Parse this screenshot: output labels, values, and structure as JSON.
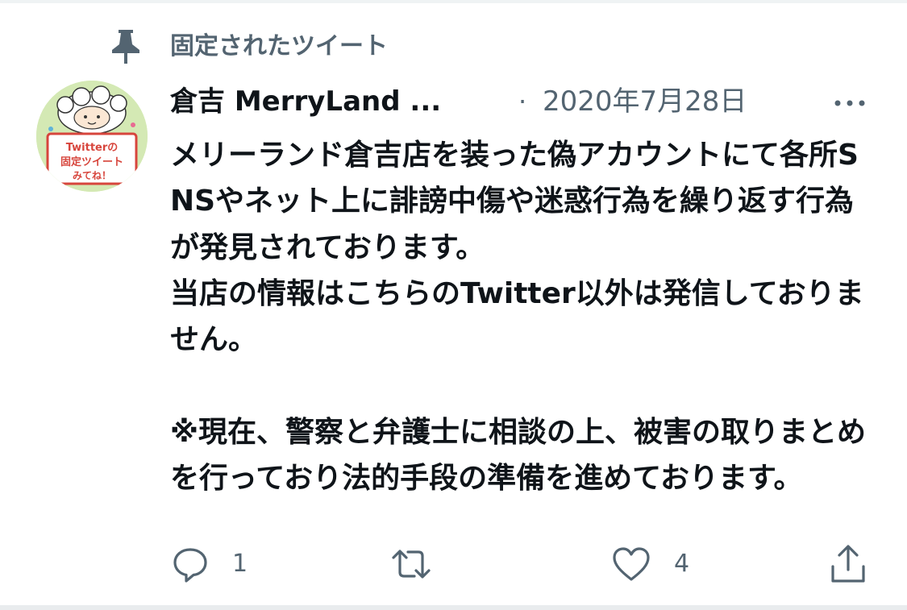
{
  "pinned": {
    "label": "固定されたツイート"
  },
  "tweet": {
    "display_name": "倉吉 MerryLand ...",
    "separator": "·",
    "timestamp": "2020年7月28日",
    "body": "メリーランド倉吉店を装った偽アカウントにて各所SNSやネット上に誹謗中傷や迷惑行為を繰り返す行為が発見されております。\n当店の情報はこちらのTwitter以外は発信しておりません。\n\n※現在、警察と弁護士に相談の上、被害の取りまとめを行っており法的手段の準備を進めております。"
  },
  "avatar": {
    "sign_line1": "Twitterの",
    "sign_line2": "固定ツイート",
    "sign_line3": "みてね！"
  },
  "actions": {
    "reply_count": "1",
    "retweet_count": "",
    "like_count": "4"
  },
  "icons": {
    "pin": "pin-icon",
    "more": "more-icon",
    "reply": "reply-icon",
    "retweet": "retweet-icon",
    "like": "heart-icon",
    "share": "share-icon"
  },
  "colors": {
    "primary_text": "#0f1419",
    "secondary_text": "#536471",
    "divider": "#eff3f4"
  }
}
